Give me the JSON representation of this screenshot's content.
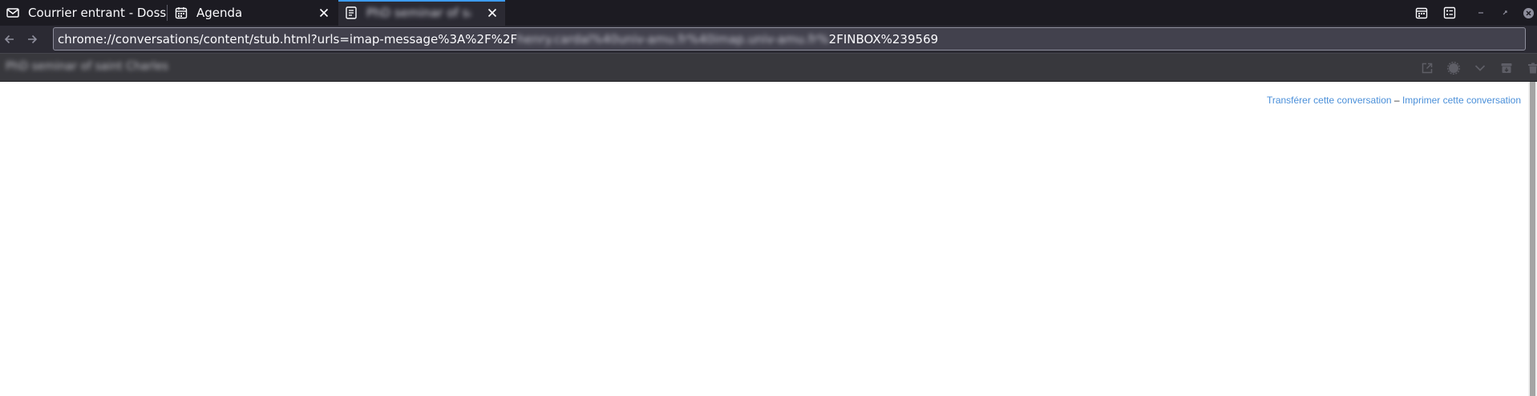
{
  "tabs": [
    {
      "label": "Courrier entrant - Dossiers",
      "icon": "mail-icon",
      "closable": false,
      "active": false
    },
    {
      "label": "Agenda",
      "icon": "calendar-icon",
      "closable": true,
      "active": false
    },
    {
      "label": "PhD seminar of saint Charles",
      "icon": "message-icon",
      "closable": true,
      "active": true,
      "obscured": true
    }
  ],
  "window_controls": [
    "calendar-icon",
    "tasks-icon",
    "minimize-icon",
    "restore-icon",
    "close-icon"
  ],
  "navigation": {
    "back_icon": "arrow-left-icon",
    "forward_icon": "arrow-right-icon"
  },
  "url": {
    "prefix": "chrome://conversations/content/stub.html?urls=imap-message%3A%2F%2F",
    "obscured": "henry.cardal%40univ-amu.fr%40imap.univ-amu.fr%",
    "suffix": "2FINBOX%239569"
  },
  "conversation": {
    "subject": "PhD seminar of saint Charles",
    "subject_obscured": true,
    "actions": [
      "open-external-icon",
      "tag-icon",
      "chevron-down-icon",
      "archive-icon",
      "trash-icon"
    ]
  },
  "links": {
    "forward": "Transférer cette conversation",
    "separator": "–",
    "print": "Imprimer cette conversation"
  },
  "colors": {
    "tab_strip": "#1c1b22",
    "toolbar": "#2b2a33",
    "subject_bar": "#38383d",
    "accent": "#3d9bf0",
    "link": "#4a8fd9"
  }
}
